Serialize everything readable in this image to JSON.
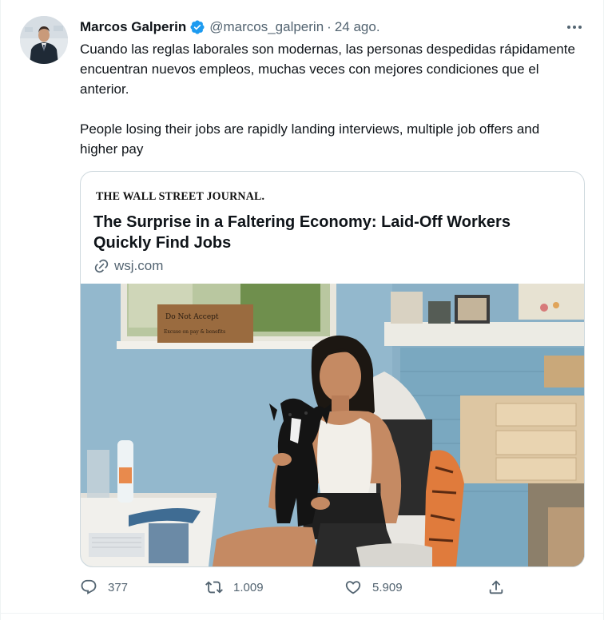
{
  "tweet": {
    "author_name": "Marcos Galperin",
    "author_handle": "@marcos_galperin",
    "separator": "·",
    "date": "24 ago.",
    "text_es": "Cuando las reglas laborales son modernas, las personas despedidas rápidamente encuentran nuevos empleos, muchas veces con mejores condiciones que el anterior.",
    "text_en": "People losing their jobs are rapidly landing interviews, multiple job offers and higher pay"
  },
  "card": {
    "publisher": "THE WALL STREET JOURNAL.",
    "title": "The Surprise in a Faltering Economy: Laid-Off Workers Quickly Find Jobs",
    "domain": "wsj.com",
    "sign_text_1": "Do Not Accept",
    "sign_text_2": "Excuse on pay & benefits"
  },
  "actions": {
    "replies": "377",
    "retweets": "1.009",
    "likes": "5.909"
  },
  "icons": {
    "verified": "verified-badge-icon",
    "more": "more-dots-icon",
    "link": "link-icon",
    "reply": "reply-icon",
    "retweet": "retweet-icon",
    "like": "heart-icon",
    "share": "share-icon"
  },
  "colors": {
    "text_primary": "#0f1419",
    "text_secondary": "#536471",
    "verified_blue": "#1d9bf0",
    "border": "#cfd9de"
  }
}
